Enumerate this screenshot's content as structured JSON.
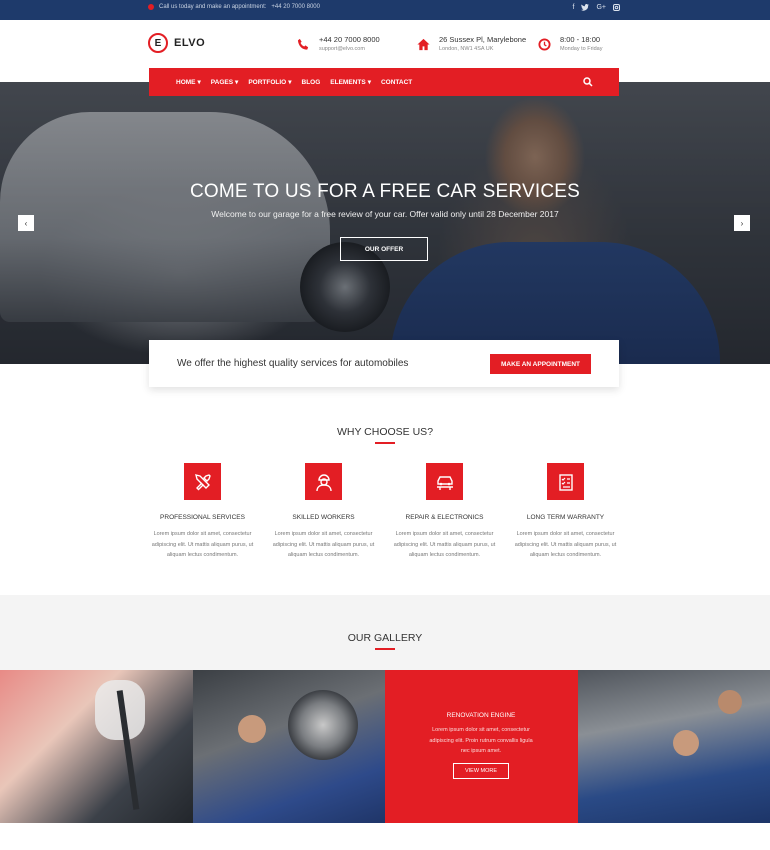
{
  "topbar": {
    "notice": "Call us today and make an appointment:",
    "phone": "+44 20 7000 8000",
    "social": [
      "f",
      "t",
      "G+",
      "ig"
    ]
  },
  "header": {
    "logo_mark": "E",
    "logo_text": "ELVO",
    "contacts": [
      {
        "icon": "phone-icon",
        "line1": "+44 20 7000 8000",
        "line2": "support@elvo.com"
      },
      {
        "icon": "home-icon",
        "line1": "26 Sussex Pl, Marylebone",
        "line2": "London, NW1 4SA UK"
      },
      {
        "icon": "clock-icon",
        "line1": "8:00 - 18:00",
        "line2": "Monday to Friday"
      }
    ]
  },
  "nav": {
    "items": [
      {
        "label": "HOME",
        "dropdown": true
      },
      {
        "label": "PAGES",
        "dropdown": true
      },
      {
        "label": "PORTFOLIO",
        "dropdown": true
      },
      {
        "label": "BLOG",
        "dropdown": false
      },
      {
        "label": "ELEMENTS",
        "dropdown": true
      },
      {
        "label": "CONTACT",
        "dropdown": false
      }
    ]
  },
  "hero": {
    "title": "COME TO US FOR A FREE CAR SERVICES",
    "subtitle": "Welcome to our garage for a free review of your car. Offer valid only until 28 December 2017",
    "button": "OUR OFFER",
    "prev": "‹",
    "next": "›"
  },
  "cta": {
    "text": "We offer the highest quality services for automobiles",
    "button": "MAKE AN APPOINTMENT"
  },
  "why": {
    "title": "WHY CHOOSE US?",
    "features": [
      {
        "name": "PROFESSIONAL SERVICES",
        "desc": "Lorem ipsum dolor sit amet, consectetur adipiscing elit. Ut mattis aliquam purus, ut aliquam lectus condimentum.",
        "icon": "tools-icon"
      },
      {
        "name": "SKILLED WORKERS",
        "desc": "Lorem ipsum dolor sit amet, consectetur adipiscing elit. Ut mattis aliquam purus, ut aliquam lectus condimentum.",
        "icon": "worker-icon"
      },
      {
        "name": "REPAIR & ELECTRONICS",
        "desc": "Lorem ipsum dolor sit amet, consectetur adipiscing elit. Ut mattis aliquam purus, ut aliquam lectus condimentum.",
        "icon": "car-lift-icon"
      },
      {
        "name": "LONG TERM WARRANTY",
        "desc": "Lorem ipsum dolor sit amet, consectetur adipiscing elit. Ut mattis aliquam purus, ut aliquam lectus condimentum.",
        "icon": "checklist-icon"
      }
    ]
  },
  "gallery": {
    "title": "OUR GALLERY",
    "overlay": {
      "title": "RENOVATION ENGINE",
      "text": "Lorem ipsum dolor sit amet, consectetur adipiscing elit. Proin rutrum convallis ligula nec ipsum amet.",
      "button": "VIEW MORE"
    }
  },
  "colors": {
    "accent": "#e31e24",
    "topbar": "#1e3a6b"
  }
}
